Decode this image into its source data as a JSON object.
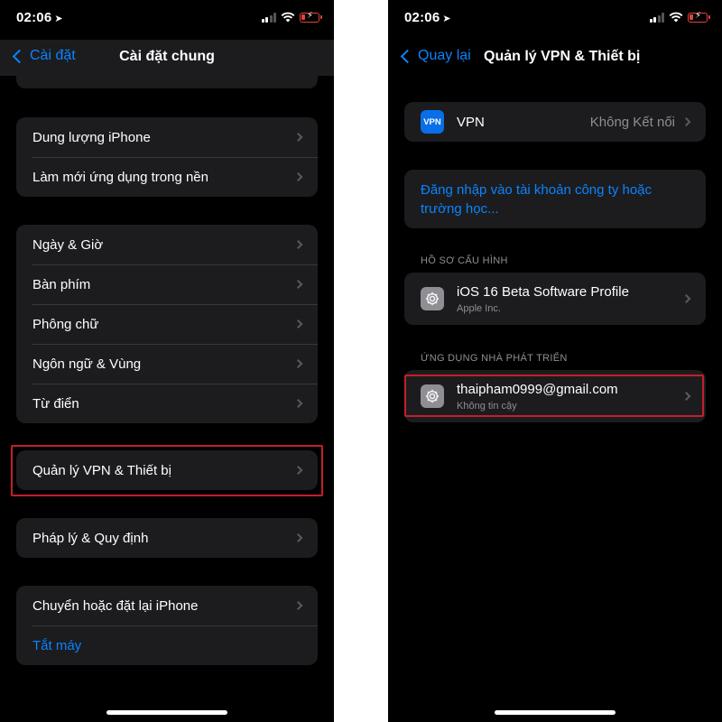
{
  "left_screen": {
    "status": {
      "time": "02:06"
    },
    "nav": {
      "back_label": "Cài đặt",
      "title": "Cài đặt chung"
    },
    "group_storage": [
      "Dung lượng iPhone",
      "Làm mới ứng dụng trong nền"
    ],
    "group_locale": [
      "Ngày & Giờ",
      "Bàn phím",
      "Phông chữ",
      "Ngôn ngữ & Vùng",
      "Từ điển"
    ],
    "group_vpn": [
      "Quản lý VPN & Thiết bị"
    ],
    "group_legal": [
      "Pháp lý & Quy định"
    ],
    "group_reset": {
      "transfer": "Chuyển hoặc đặt lại iPhone",
      "shutdown": "Tắt máy"
    }
  },
  "right_screen": {
    "status": {
      "time": "02:06"
    },
    "nav": {
      "back_label": "Quay lại",
      "title": "Quản lý VPN & Thiết bị"
    },
    "vpn": {
      "icon_text": "VPN",
      "label": "VPN",
      "status": "Không Kết nối"
    },
    "signin": {
      "line1": "Đăng nhập vào tài khoản công ty hoặc",
      "line2": "trường học..."
    },
    "profiles_header": "HỒ SƠ CẤU HÌNH",
    "profile": {
      "name": "iOS 16 Beta Software Profile",
      "sub": "Apple Inc."
    },
    "developer_header": "ỨNG DỤNG NHÀ PHÁT TRIỂN",
    "developer": {
      "name": "thaipham0999@gmail.com",
      "sub": "Không tin cậy"
    }
  },
  "colors": {
    "accent": "#0a84ff",
    "highlight": "#c2202a",
    "cell": "#1c1c1e",
    "battery": "#e0443c"
  },
  "icons": [
    "location-arrow-icon",
    "signal-icon",
    "wifi-icon",
    "battery-charging-icon",
    "chevron-left-icon",
    "chevron-right-icon",
    "gear-icon"
  ]
}
